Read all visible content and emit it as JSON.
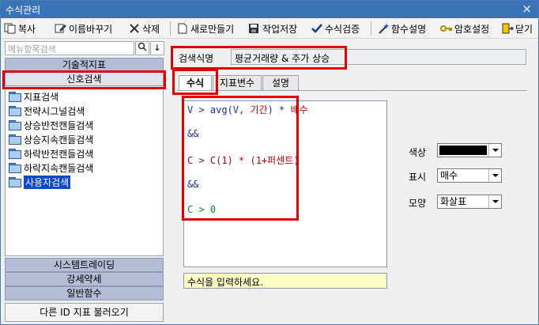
{
  "window": {
    "title": "수식관리",
    "close_icon": "×"
  },
  "toolbar": {
    "copy": "복사",
    "rename": "이름바꾸기",
    "delete": "삭제",
    "new": "새로만들기",
    "save": "작업저장",
    "verify": "수식검증",
    "func_help": "함수설명",
    "password": "암호설정",
    "close": "닫기"
  },
  "search": {
    "placeholder": "메뉴항목검색",
    "search_icon": "magnifier",
    "down_icon": "↓"
  },
  "categories": {
    "technical": "기술적지표",
    "signal": "신호검색",
    "system": "시스템트레이딩",
    "strength": "강세약세",
    "general": "일반함수"
  },
  "tree": {
    "items": [
      "지표검색",
      "전략시그널검색",
      "상승반전캔들검색",
      "상승지속캔들검색",
      "하락반전캔들검색",
      "하락지속캔들검색",
      "사용자검색"
    ]
  },
  "load_button": "다른 ID 지표 불러오기",
  "formula": {
    "name_label": "검색식명",
    "name_value": "평균거래량 & 주가 상승",
    "tabs": [
      "수식",
      "지표변수",
      "설명"
    ],
    "lines": {
      "l1a": "V > avg(V, ",
      "l1b": "기간",
      "l1c": ") * ",
      "l1d": "배수",
      "l2": "&&",
      "l3a": "C > C(1) * (1+",
      "l3b": "퍼센트",
      "l3c": ")",
      "l4": "&&",
      "l5": "C > 0"
    },
    "hint": "수식을 입력하세요."
  },
  "options": {
    "color_label": "색상",
    "color_value": "#000000",
    "display_label": "표시",
    "display_value": "매수",
    "shape_label": "모양",
    "shape_value": "화살표"
  },
  "colors": {
    "accent": "#3b73b9",
    "highlight": "#e00000",
    "selected": "#0a49c9"
  }
}
